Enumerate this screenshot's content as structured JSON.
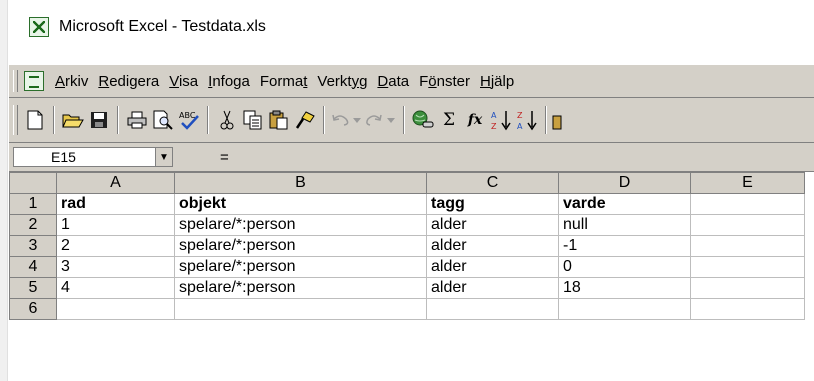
{
  "window": {
    "title": "Microsoft Excel - Testdata.xls",
    "icon": "excel-icon"
  },
  "menu": {
    "items": [
      {
        "pre": "",
        "u": "A",
        "post": "rkiv"
      },
      {
        "pre": "",
        "u": "R",
        "post": "edigera"
      },
      {
        "pre": "",
        "u": "V",
        "post": "isa"
      },
      {
        "pre": "",
        "u": "I",
        "post": "nfoga"
      },
      {
        "pre": "Forma",
        "u": "t",
        "post": ""
      },
      {
        "pre": "Verkt",
        "u": "y",
        "post": "g"
      },
      {
        "pre": "",
        "u": "D",
        "post": "ata"
      },
      {
        "pre": "F",
        "u": "ö",
        "post": "nster"
      },
      {
        "pre": "",
        "u": "H",
        "post": "jälp"
      }
    ]
  },
  "toolbar": {
    "buttons": [
      "new-icon",
      "open-icon",
      "save-icon",
      "print-icon",
      "print-preview-icon",
      "spelling-icon",
      "cut-icon",
      "copy-icon",
      "paste-icon",
      "format-painter-icon",
      "undo-icon",
      "redo-icon",
      "hyperlink-icon",
      "autosum-icon",
      "function-icon",
      "sort-ascending-icon",
      "sort-descending-icon"
    ],
    "autosum_glyph": "Σ",
    "function_glyph": "fx"
  },
  "formula_bar": {
    "cell_ref": "E15",
    "equals": "=",
    "formula": ""
  },
  "sheet": {
    "columns": [
      "A",
      "B",
      "C",
      "D",
      "E"
    ],
    "rows": [
      {
        "num": "1",
        "cells": [
          "rad",
          "objekt",
          "tagg",
          "varde",
          ""
        ]
      },
      {
        "num": "2",
        "cells": [
          "1",
          "spelare/*:person",
          "alder",
          "null",
          ""
        ]
      },
      {
        "num": "3",
        "cells": [
          "2",
          "spelare/*:person",
          "alder",
          "-1",
          ""
        ]
      },
      {
        "num": "4",
        "cells": [
          "3",
          "spelare/*:person",
          "alder",
          "0",
          ""
        ]
      },
      {
        "num": "5",
        "cells": [
          "4",
          "spelare/*:person",
          "alder",
          "18",
          ""
        ]
      },
      {
        "num": "6",
        "cells": [
          "",
          "",
          "",
          "",
          ""
        ]
      }
    ]
  }
}
